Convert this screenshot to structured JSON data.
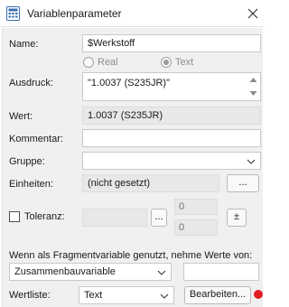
{
  "window": {
    "title": "Variablenparameter",
    "icon": "calculator-icon",
    "close_icon": "close-icon"
  },
  "name": {
    "label": "Name:",
    "value": "$Werkstoff"
  },
  "type_radio": {
    "real_label": "Real",
    "text_label": "Text",
    "selected": "Text"
  },
  "ausdruck": {
    "label": "Ausdruck:",
    "value": "\"1.0037 (S235JR)\""
  },
  "wert": {
    "label": "Wert:",
    "value": "1.0037 (S235JR)"
  },
  "kommentar": {
    "label": "Kommentar:",
    "value": ""
  },
  "gruppe": {
    "label": "Gruppe:",
    "value": ""
  },
  "einheiten": {
    "label": "Einheiten:",
    "value": "(nicht gesetzt)",
    "button": "..."
  },
  "toleranz": {
    "label": "Toleranz:",
    "checked": false,
    "button": "...",
    "upper": "0",
    "lower": "0",
    "pm_button": "±"
  },
  "fragment": {
    "text": "Wenn als Fragmentvariable genutzt, nehme Werte von:",
    "source": "Zusammenbauvariable",
    "value": ""
  },
  "wertliste": {
    "label": "Wertliste:",
    "type": "Text",
    "edit_button": "Bearbeiten...",
    "status_color": "#e31e24"
  }
}
